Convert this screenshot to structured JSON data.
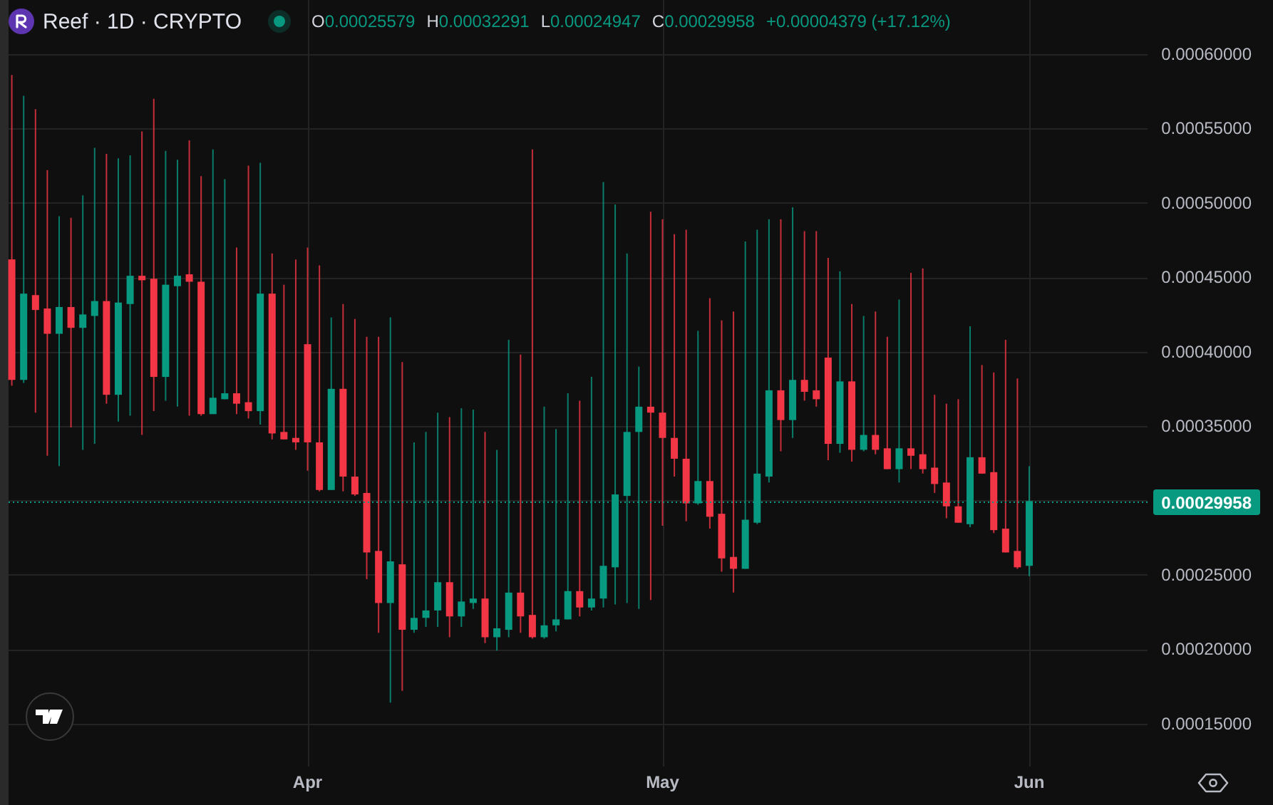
{
  "header": {
    "symbol": "Reef · 1D · CRYPTO",
    "market_open": true,
    "ohlc": [
      {
        "label": "O",
        "value": "0.00025579"
      },
      {
        "label": "H",
        "value": "0.00032291"
      },
      {
        "label": "L",
        "value": "0.00024947"
      },
      {
        "label": "C",
        "value": "0.00029958"
      }
    ],
    "change": "+0.00004379 (+17.12%)"
  },
  "chart": {
    "current_price": "0.00029958",
    "price_axis": [
      "0.00060000",
      "0.00055000",
      "0.00050000",
      "0.00045000",
      "0.00040000",
      "0.00035000",
      "0.00025000",
      "0.00020000",
      "0.00015000"
    ],
    "time_axis": [
      "Apr",
      "May",
      "Jun"
    ]
  }
}
